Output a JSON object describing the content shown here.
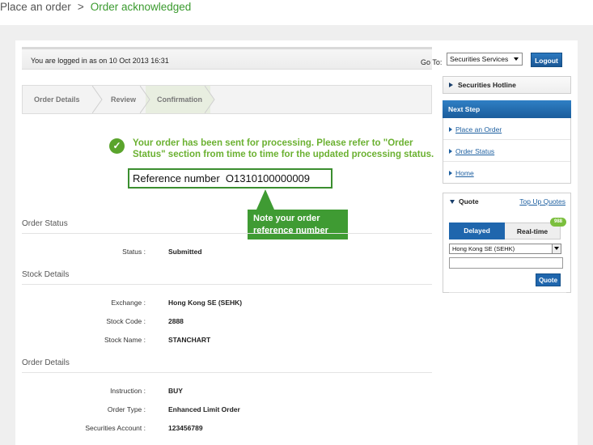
{
  "breadcrumb": {
    "parent": "Place an order",
    "separator": ">",
    "current": "Order acknowledged"
  },
  "topbar": {
    "login_text": "You are logged in as on 10 Oct 2013 16:31",
    "goto_label": "Go To:",
    "goto_selected": "Securities Services",
    "logout_label": "Logout"
  },
  "steps": [
    "Order Details",
    "Review",
    "Confirmation"
  ],
  "confirmation": {
    "message": "Your order has been sent for processing. Please refer to \"Order Status\" section from time to time for the updated processing status.",
    "reference_label": "Reference number",
    "reference_number": "O1310100000009",
    "callout": "Note your order reference number"
  },
  "sections": {
    "order_status": {
      "title": "Order Status",
      "rows": [
        {
          "label": "Status :",
          "value": "Submitted"
        }
      ]
    },
    "stock_details": {
      "title": "Stock Details",
      "rows": [
        {
          "label": "Exchange :",
          "value": "Hong Kong SE (SEHK)"
        },
        {
          "label": "Stock Code :",
          "value": "2888"
        },
        {
          "label": "Stock Name :",
          "value": "STANCHART"
        }
      ]
    },
    "order_details": {
      "title": "Order Details",
      "rows": [
        {
          "label": "Instruction :",
          "value": "BUY"
        },
        {
          "label": "Order Type :",
          "value": "Enhanced Limit Order"
        },
        {
          "label": "Securities Account :",
          "value": "123456789"
        }
      ]
    }
  },
  "sidebar": {
    "hotline": "Securities Hotline",
    "next_step": {
      "title": "Next Step",
      "items": [
        "Place an Order",
        "Order Status",
        "Home"
      ]
    },
    "quote": {
      "title": "Quote",
      "top_up": "Top Up Quotes",
      "tab_delayed": "Delayed",
      "tab_realtime": "Real-time",
      "badge": "988",
      "exchange_selected": "Hong Kong SE (SEHK)",
      "button": "Quote"
    }
  },
  "colors": {
    "accent_green": "#3a9a2e",
    "message_green": "#6bb131",
    "brand_blue": "#1f66ad"
  }
}
